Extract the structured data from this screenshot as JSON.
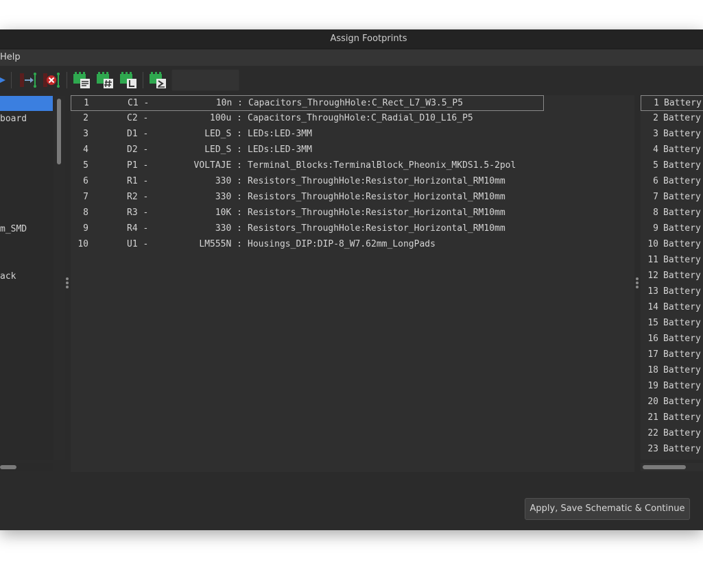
{
  "window": {
    "title": "Assign Footprints"
  },
  "menubar": {
    "help": "Help"
  },
  "libraries": [
    {
      "name": "",
      "selected": true
    },
    {
      "name": "board"
    },
    {
      "name": ""
    },
    {
      "name": ""
    },
    {
      "name": ""
    },
    {
      "name": ""
    },
    {
      "name": ""
    },
    {
      "name": ""
    },
    {
      "name": "m_SMD"
    },
    {
      "name": ""
    },
    {
      "name": ""
    },
    {
      "name": "ack"
    }
  ],
  "components": [
    {
      "index": "1",
      "ref": "C1 -",
      "value": "10n :",
      "footprint": "Capacitors_ThroughHole:C_Rect_L7_W3.5_P5",
      "selected": true
    },
    {
      "index": "2",
      "ref": "C2 -",
      "value": "100u :",
      "footprint": "Capacitors_ThroughHole:C_Radial_D10_L16_P5"
    },
    {
      "index": "3",
      "ref": "D1 -",
      "value": "LED_S :",
      "footprint": "LEDs:LED-3MM"
    },
    {
      "index": "4",
      "ref": "D2 -",
      "value": "LED_S :",
      "footprint": "LEDs:LED-3MM"
    },
    {
      "index": "5",
      "ref": "P1 -",
      "value": "VOLTAJE :",
      "footprint": "Terminal_Blocks:TerminalBlock_Pheonix_MKDS1.5-2pol"
    },
    {
      "index": "6",
      "ref": "R1 -",
      "value": "330 :",
      "footprint": "Resistors_ThroughHole:Resistor_Horizontal_RM10mm"
    },
    {
      "index": "7",
      "ref": "R2 -",
      "value": "330 :",
      "footprint": "Resistors_ThroughHole:Resistor_Horizontal_RM10mm"
    },
    {
      "index": "8",
      "ref": "R3 -",
      "value": "10K :",
      "footprint": "Resistors_ThroughHole:Resistor_Horizontal_RM10mm"
    },
    {
      "index": "9",
      "ref": "R4 -",
      "value": "330 :",
      "footprint": "Resistors_ThroughHole:Resistor_Horizontal_RM10mm"
    },
    {
      "index": "10",
      "ref": "U1 -",
      "value": "LM555N :",
      "footprint": "Housings_DIP:DIP-8_W7.62mm_LongPads"
    }
  ],
  "footprints": [
    {
      "index": "1",
      "name": "Battery",
      "selected": true
    },
    {
      "index": "2",
      "name": "Battery"
    },
    {
      "index": "3",
      "name": "Battery"
    },
    {
      "index": "4",
      "name": "Battery"
    },
    {
      "index": "5",
      "name": "Battery"
    },
    {
      "index": "6",
      "name": "Battery"
    },
    {
      "index": "7",
      "name": "Battery"
    },
    {
      "index": "8",
      "name": "Battery"
    },
    {
      "index": "9",
      "name": "Battery"
    },
    {
      "index": "10",
      "name": "Battery"
    },
    {
      "index": "11",
      "name": "Battery"
    },
    {
      "index": "12",
      "name": "Battery"
    },
    {
      "index": "13",
      "name": "Battery"
    },
    {
      "index": "14",
      "name": "Battery"
    },
    {
      "index": "15",
      "name": "Battery"
    },
    {
      "index": "16",
      "name": "Battery"
    },
    {
      "index": "17",
      "name": "Battery"
    },
    {
      "index": "18",
      "name": "Battery"
    },
    {
      "index": "19",
      "name": "Battery"
    },
    {
      "index": "20",
      "name": "Battery"
    },
    {
      "index": "21",
      "name": "Battery"
    },
    {
      "index": "22",
      "name": "Battery"
    },
    {
      "index": "23",
      "name": "Battery"
    }
  ],
  "buttons": {
    "apply": "Apply, Save Schematic & Continue"
  },
  "toolbar": {
    "icons": [
      "next-arrow-icon",
      "auto-associate-icon",
      "delete-association-icon",
      "filter-by-keyword-icon",
      "filter-by-pin-count-icon",
      "filter-by-library-icon",
      "filter-by-name-icon"
    ]
  },
  "colors": {
    "selection": "#3b7fe0",
    "footprint_green": "#2fa84f"
  }
}
